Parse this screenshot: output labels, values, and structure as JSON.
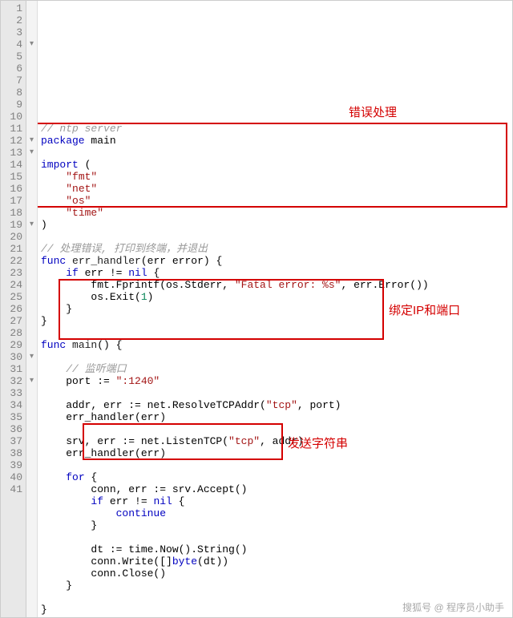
{
  "lines": [
    {
      "n": 1,
      "fold": "",
      "html": "<span class='com'>// ntp server</span>"
    },
    {
      "n": 2,
      "fold": "",
      "html": "<span class='kw'>package</span> main"
    },
    {
      "n": 3,
      "fold": "",
      "html": ""
    },
    {
      "n": 4,
      "fold": "▾",
      "html": "<span class='kw'>import</span> ("
    },
    {
      "n": 5,
      "fold": "",
      "html": "    <span class='str'>\"fmt\"</span>"
    },
    {
      "n": 6,
      "fold": "",
      "html": "    <span class='str'>\"net\"</span>"
    },
    {
      "n": 7,
      "fold": "",
      "html": "    <span class='str'>\"os\"</span>"
    },
    {
      "n": 8,
      "fold": "",
      "html": "    <span class='str'>\"time\"</span>"
    },
    {
      "n": 9,
      "fold": "",
      "html": ")"
    },
    {
      "n": 10,
      "fold": "",
      "html": ""
    },
    {
      "n": 11,
      "fold": "",
      "html": "<span class='com'>// 处理错误, 打印到终端，并退出</span>"
    },
    {
      "n": 12,
      "fold": "▾",
      "html": "<span class='kw'>func</span> <span class='fn'>err_handler</span>(err error) {"
    },
    {
      "n": 13,
      "fold": "▾",
      "html": "    <span class='kw'>if</span> err != <span class='kw'>nil</span> {"
    },
    {
      "n": 14,
      "fold": "",
      "html": "        fmt.Fprintf(os.Stderr, <span class='str'>\"Fatal error: %s\"</span>, err.Error())"
    },
    {
      "n": 15,
      "fold": "",
      "html": "        os.Exit(<span class='num'>1</span>)"
    },
    {
      "n": 16,
      "fold": "",
      "html": "    }"
    },
    {
      "n": 17,
      "fold": "",
      "html": "}"
    },
    {
      "n": 18,
      "fold": "",
      "html": ""
    },
    {
      "n": 19,
      "fold": "▾",
      "html": "<span class='kw'>func</span> <span class='fn'>main</span>() {"
    },
    {
      "n": 20,
      "fold": "",
      "html": ""
    },
    {
      "n": 21,
      "fold": "",
      "html": "    <span class='com'>// 监听端口</span>"
    },
    {
      "n": 22,
      "fold": "",
      "html": "    port := <span class='str'>\":1240\"</span>"
    },
    {
      "n": 23,
      "fold": "",
      "html": ""
    },
    {
      "n": 24,
      "fold": "",
      "html": "    addr, err := net.ResolveTCPAddr(<span class='str'>\"tcp\"</span>, port)"
    },
    {
      "n": 25,
      "fold": "",
      "html": "    err_handler(err)"
    },
    {
      "n": 26,
      "fold": "",
      "html": ""
    },
    {
      "n": 27,
      "fold": "",
      "html": "    srv, err := net.ListenTCP(<span class='str'>\"tcp\"</span>, addr)"
    },
    {
      "n": 28,
      "fold": "",
      "html": "    err_handler(err)"
    },
    {
      "n": 29,
      "fold": "",
      "html": ""
    },
    {
      "n": 30,
      "fold": "▾",
      "html": "    <span class='kw'>for</span> {"
    },
    {
      "n": 31,
      "fold": "",
      "html": "        conn, err := srv.Accept()"
    },
    {
      "n": 32,
      "fold": "▾",
      "html": "        <span class='kw'>if</span> err != <span class='kw'>nil</span> {"
    },
    {
      "n": 33,
      "fold": "",
      "html": "            <span class='kw'>continue</span>"
    },
    {
      "n": 34,
      "fold": "",
      "html": "        }"
    },
    {
      "n": 35,
      "fold": "",
      "html": ""
    },
    {
      "n": 36,
      "fold": "",
      "html": "        dt := time.Now().String()"
    },
    {
      "n": 37,
      "fold": "",
      "html": "        conn.Write([]<span class='kw'>byte</span>(dt))"
    },
    {
      "n": 38,
      "fold": "",
      "html": "        conn.Close()"
    },
    {
      "n": 39,
      "fold": "",
      "html": "    }"
    },
    {
      "n": 40,
      "fold": "",
      "html": ""
    },
    {
      "n": 41,
      "fold": "",
      "html": "}"
    }
  ],
  "annotations": {
    "a1": "错误处理",
    "a2": "绑定IP和端口",
    "a3": "发送字符串"
  },
  "watermark": "搜狐号 @ 程序员小助手"
}
